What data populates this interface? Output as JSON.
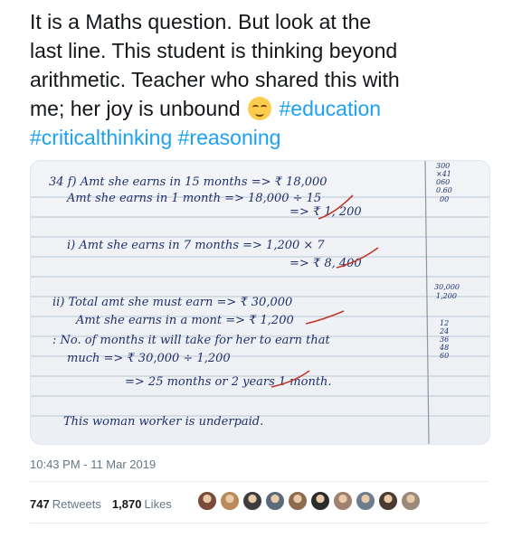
{
  "tweet": {
    "text_line1": "It is a Maths question. But look at the",
    "text_line2": "last line. This student is thinking beyond",
    "text_line3": "arithmetic.  Teacher who shared this with",
    "text_line4": "me; her joy is unbound",
    "hashtags": [
      "#education",
      "#criticalthinking",
      "#reasoning"
    ],
    "emoji": "relieved-face-emoji"
  },
  "notebook": {
    "lines": [
      "34 f) Amt she earns in 15 months => ₹ 18,000",
      "Amt she earns in 1 month => 18,000 ÷ 15",
      "=> ₹ 1, 200",
      "i) Amt she earns in 7 months => 1,200 × 7",
      "=> ₹ 8, 400",
      "ii) Total amt she must earn => ₹ 30,000",
      "Amt she earns in a mont => ₹ 1,200",
      ": No. of months it will take for her to earn that",
      "much => ₹ 30,000 ÷ 1,200",
      "=> 25 months or 2 years 1 month.",
      "This woman worker is underpaid."
    ],
    "margin_top": [
      "300",
      "×41",
      "060",
      "0.60",
      "00"
    ],
    "margin_mid": [
      "30,000",
      "1,200"
    ],
    "margin_low": [
      "12",
      "24",
      "36",
      "48",
      "60"
    ]
  },
  "timestamp": "10:43 PM - 11 Mar 2019",
  "stats": {
    "retweets_count": "747",
    "retweets_label": "Retweets",
    "likes_count": "1,870",
    "likes_label": "Likes"
  },
  "avatar_colors": [
    "#7a4a3a",
    "#b88a5c",
    "#3d3d3d",
    "#5a6a7a",
    "#8c6b4f",
    "#2b2b2b",
    "#a08070",
    "#6b7d8c",
    "#4a3a30",
    "#9a8a7a"
  ]
}
